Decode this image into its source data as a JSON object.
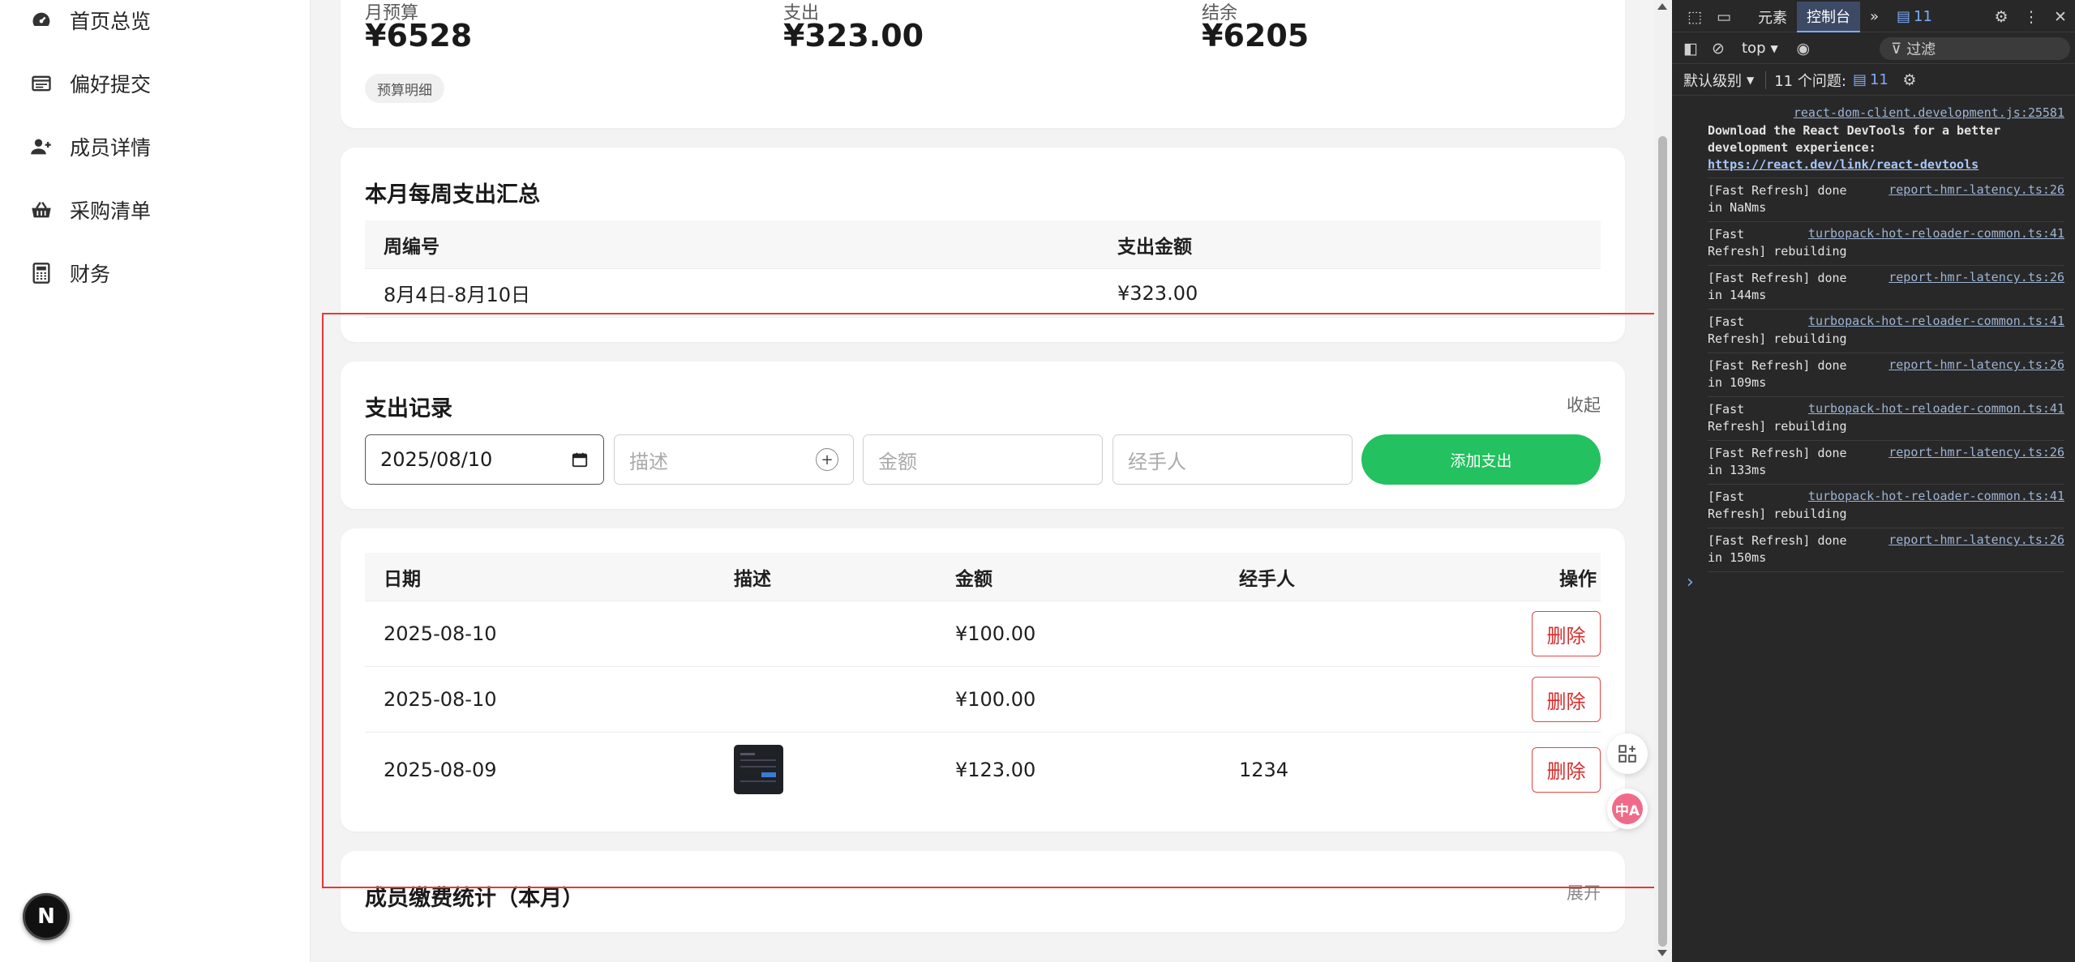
{
  "sidebar": {
    "items": [
      {
        "label": "首页总览",
        "icon": "dashboard-icon"
      },
      {
        "label": "偏好提交",
        "icon": "list-icon"
      },
      {
        "label": "成员详情",
        "icon": "user-add-icon"
      },
      {
        "label": "采购清单",
        "icon": "basket-icon"
      },
      {
        "label": "财务",
        "icon": "calculator-icon"
      }
    ],
    "badge": "N"
  },
  "budget": {
    "monthly_label": "月预算",
    "monthly_value": "¥6528",
    "expense_label": "支出",
    "expense_value": "¥323.00",
    "balance_label": "结余",
    "balance_value": "¥6205",
    "detail_label": "预算明细"
  },
  "weekly": {
    "title": "本月每周支出汇总",
    "headers": [
      "周编号",
      "支出金额"
    ],
    "rows": [
      [
        "8月4日-8月10日",
        "¥323.00"
      ]
    ]
  },
  "records": {
    "title": "支出记录",
    "collapse_label": "收起",
    "date_value": "2025/08/10",
    "desc_placeholder": "描述",
    "amount_placeholder": "金额",
    "handler_placeholder": "经手人",
    "add_label": "添加支出"
  },
  "expense_table": {
    "headers": [
      "日期",
      "描述",
      "金额",
      "经手人",
      "操作"
    ],
    "rows": [
      {
        "date": "2025-08-10",
        "desc": "",
        "has_image": false,
        "amount": "¥100.00",
        "handler": "",
        "action": "删除"
      },
      {
        "date": "2025-08-10",
        "desc": "",
        "has_image": false,
        "amount": "¥100.00",
        "handler": "",
        "action": "删除"
      },
      {
        "date": "2025-08-09",
        "desc": "",
        "has_image": true,
        "amount": "¥123.00",
        "handler": "1234",
        "action": "删除"
      }
    ]
  },
  "fee": {
    "title": "成员缴费统计（本月）",
    "expand_label": "展开"
  },
  "devtools": {
    "tabs": {
      "elements": "元素",
      "console": "控制台",
      "more": "»",
      "issues_count": "11"
    },
    "context": "top",
    "filter_placeholder": "过滤",
    "level": "默认级别",
    "issues_label": "11 个问题:",
    "issues_badge": "11",
    "logs": [
      {
        "link": "react-dom-client.development.js:25581",
        "text": "Download the React DevTools for a better\ndevelopment experience:",
        "url": "https://react.dev/link/react-devtools"
      },
      {
        "link": "report-hmr-latency.ts:26",
        "text": "[Fast Refresh] done\nin NaNms"
      },
      {
        "link": "turbopack-hot-reloader-common.ts:41",
        "text": "[Fast\nRefresh] rebuilding"
      },
      {
        "link": "report-hmr-latency.ts:26",
        "text": "[Fast Refresh] done\nin 144ms"
      },
      {
        "link": "turbopack-hot-reloader-common.ts:41",
        "text": "[Fast\nRefresh] rebuilding"
      },
      {
        "link": "report-hmr-latency.ts:26",
        "text": "[Fast Refresh] done\nin 109ms"
      },
      {
        "link": "turbopack-hot-reloader-common.ts:41",
        "text": "[Fast\nRefresh] rebuilding"
      },
      {
        "link": "report-hmr-latency.ts:26",
        "text": "[Fast Refresh] done\nin 133ms"
      },
      {
        "link": "turbopack-hot-reloader-common.ts:41",
        "text": "[Fast\nRefresh] rebuilding"
      },
      {
        "link": "report-hmr-latency.ts:26",
        "text": "[Fast Refresh] done\nin 150ms"
      }
    ],
    "prompt": "›"
  },
  "colors": {
    "accent_green": "#23c15f",
    "danger_red": "#d92b2b",
    "highlight_red": "#e53935"
  }
}
